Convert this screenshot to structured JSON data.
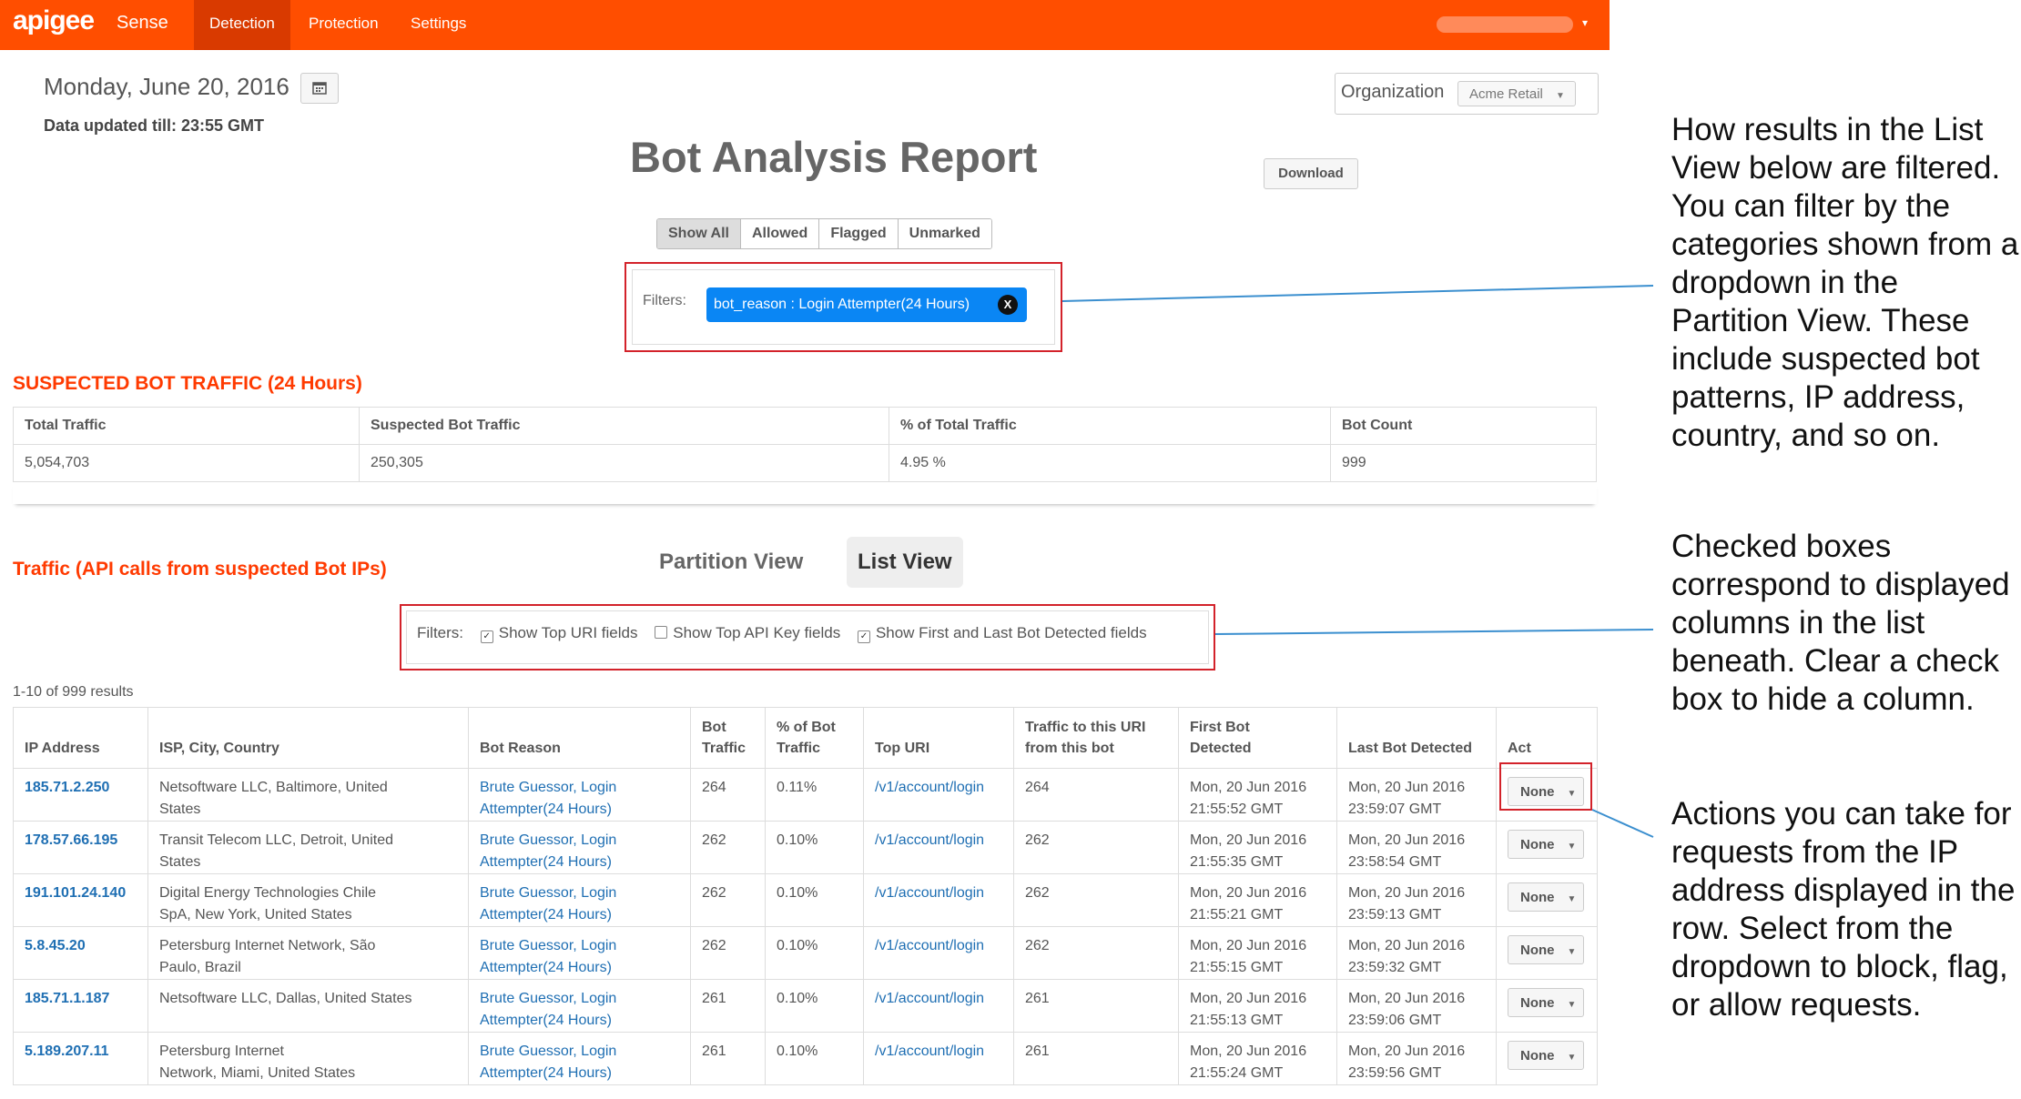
{
  "nav": {
    "brand": "apigee",
    "product": "Sense",
    "tabs": [
      {
        "label": "Detection",
        "active": true
      },
      {
        "label": "Protection",
        "active": false
      },
      {
        "label": "Settings",
        "active": false
      }
    ],
    "user_caret": "▾"
  },
  "header": {
    "date": "Monday, June 20, 2016",
    "calendar_icon": "calendar-icon",
    "data_updated": "Data updated till: 23:55 GMT",
    "organization_label": "Organization",
    "organization_value": "Acme Retail",
    "title": "Bot Analysis Report",
    "download_label": "Download"
  },
  "segmented": [
    "Show All",
    "Allowed",
    "Flagged",
    "Unmarked"
  ],
  "filters": {
    "label": "Filters:",
    "chip": "bot_reason : Login Attempter(24 Hours)",
    "chip_close": "X"
  },
  "suspected": {
    "title": "SUSPECTED BOT TRAFFIC (24 Hours)",
    "headers": [
      "Total Traffic",
      "Suspected Bot Traffic",
      "% of Total Traffic",
      "Bot Count"
    ],
    "values": [
      "5,054,703",
      "250,305",
      "4.95 %",
      "999"
    ]
  },
  "traffic": {
    "title": "Traffic (API calls from suspected Bot IPs)",
    "view_partition": "Partition View",
    "view_list": "List View",
    "filters_label": "Filters:",
    "checkbox_1": "Show Top URI fields",
    "checkbox_2": "Show Top API Key fields",
    "checkbox_3": "Show First and Last Bot Detected fields",
    "results": "1-10 of 999 results"
  },
  "table": {
    "headers": {
      "ip": "IP Address",
      "isp": "ISP, City, Country",
      "reason": "Bot Reason",
      "bot1": "Bot",
      "bot2": "Traffic",
      "pct1": "% of Bot",
      "pct2": "Traffic",
      "uri": "Top URI",
      "tr1": "Traffic to this URI",
      "tr2": "from this bot",
      "first1": "First Bot",
      "first2": "Detected",
      "last": "Last Bot Detected",
      "act": "Act"
    },
    "rows": [
      {
        "ip": "185.71.2.250",
        "isp1": "Netsoftware LLC, Baltimore, United",
        "isp2": "States",
        "r1": "Brute Guessor, Login",
        "r2": "Attempter(24 Hours)",
        "traffic": "264",
        "pct": "0.11%",
        "uri": "/v1/account/login",
        "uri_traffic": "264",
        "f1": "Mon, 20 Jun 2016",
        "f2": "21:55:52 GMT",
        "l1": "Mon, 20 Jun 2016",
        "l2": "23:59:07 GMT",
        "action": "None"
      },
      {
        "ip": "178.57.66.195",
        "isp1": "Transit Telecom LLC, Detroit, United",
        "isp2": "States",
        "r1": "Brute Guessor, Login",
        "r2": "Attempter(24 Hours)",
        "traffic": "262",
        "pct": "0.10%",
        "uri": "/v1/account/login",
        "uri_traffic": "262",
        "f1": "Mon, 20 Jun 2016",
        "f2": "21:55:35 GMT",
        "l1": "Mon, 20 Jun 2016",
        "l2": "23:58:54 GMT",
        "action": "None"
      },
      {
        "ip": "191.101.24.140",
        "isp1": "Digital Energy Technologies Chile",
        "isp2": "SpA, New York, United States",
        "r1": "Brute Guessor, Login",
        "r2": "Attempter(24 Hours)",
        "traffic": "262",
        "pct": "0.10%",
        "uri": "/v1/account/login",
        "uri_traffic": "262",
        "f1": "Mon, 20 Jun 2016",
        "f2": "21:55:21 GMT",
        "l1": "Mon, 20 Jun 2016",
        "l2": "23:59:13 GMT",
        "action": "None"
      },
      {
        "ip": "5.8.45.20",
        "isp1": "Petersburg Internet Network, São",
        "isp2": "Paulo, Brazil",
        "r1": "Brute Guessor, Login",
        "r2": "Attempter(24 Hours)",
        "traffic": "262",
        "pct": "0.10%",
        "uri": "/v1/account/login",
        "uri_traffic": "262",
        "f1": "Mon, 20 Jun 2016",
        "f2": "21:55:15 GMT",
        "l1": "Mon, 20 Jun 2016",
        "l2": "23:59:32 GMT",
        "action": "None"
      },
      {
        "ip": "185.71.1.187",
        "isp1": "Netsoftware LLC, Dallas, United States",
        "isp2": "",
        "r1": "Brute Guessor, Login",
        "r2": "Attempter(24 Hours)",
        "traffic": "261",
        "pct": "0.10%",
        "uri": "/v1/account/login",
        "uri_traffic": "261",
        "f1": "Mon, 20 Jun 2016",
        "f2": "21:55:13 GMT",
        "l1": "Mon, 20 Jun 2016",
        "l2": "23:59:06 GMT",
        "action": "None"
      },
      {
        "ip": "5.189.207.11",
        "isp1": "Petersburg Internet",
        "isp2": "Network, Miami, United States",
        "r1": "Brute Guessor, Login",
        "r2": "Attempter(24 Hours)",
        "traffic": "261",
        "pct": "0.10%",
        "uri": "/v1/account/login",
        "uri_traffic": "261",
        "f1": "Mon, 20 Jun 2016",
        "f2": "21:55:24 GMT",
        "l1": "Mon, 20 Jun 2016",
        "l2": "23:59:56 GMT",
        "action": "None"
      }
    ]
  },
  "annotations": {
    "note1": "How results in the List View below are filtered. You can filter by the categories shown from a dropdown in the Partition View. These include suspected bot patterns, IP address, country, and so on.",
    "note2": "Checked boxes correspond to displayed columns in the list beneath. Clear a check box to hide a column.",
    "note3": "Actions you can take for requests from the IP address displayed in the row. Select from the dropdown to block, flag, or allow requests."
  },
  "colors": {
    "nav": "#ff4e00",
    "accent_red": "#ff3a00",
    "chip": "#0a86f4",
    "link": "#1f6fb3",
    "callout_border": "#d3222a",
    "callout_line": "#3b8fcf"
  }
}
